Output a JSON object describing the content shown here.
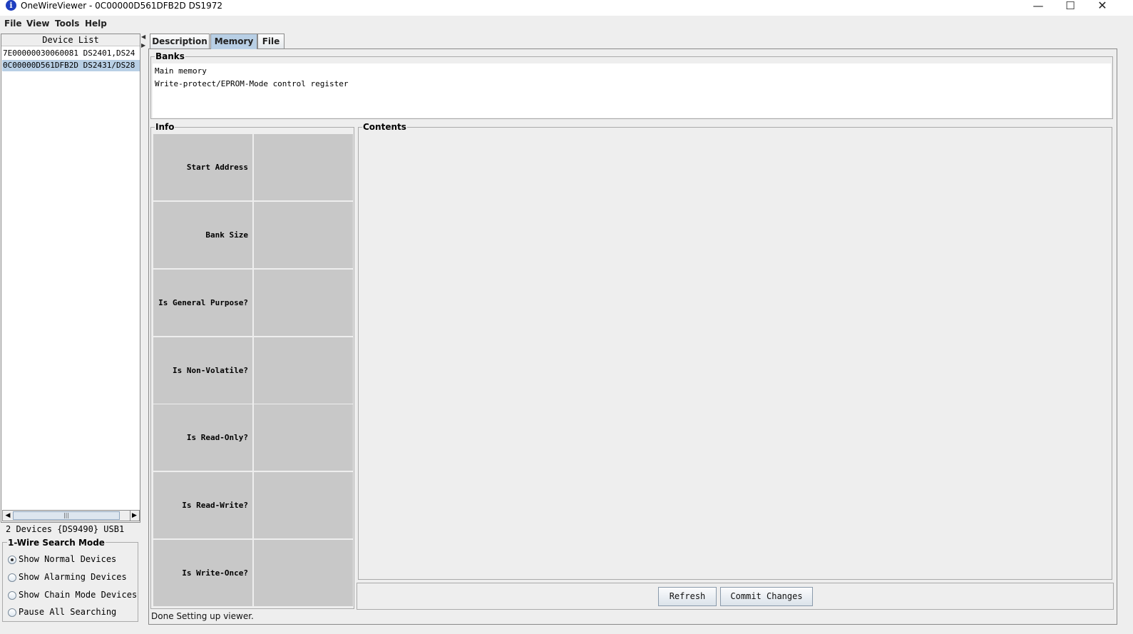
{
  "window": {
    "title": "OneWireViewer - 0C00000D561DFB2D DS1972",
    "app_icon": "info-icon",
    "minimize_glyph": "—",
    "maximize_glyph": "☐",
    "close_glyph": "✕"
  },
  "menu": [
    "File",
    "View",
    "Tools",
    "Help"
  ],
  "device_list": {
    "header": "Device List",
    "devices": [
      {
        "label": "7E00000030060081 DS2401,DS24",
        "selected": false
      },
      {
        "label": "0C00000D561DFB2D DS2431/DS28",
        "selected": true
      }
    ],
    "count_text": "2 Devices  {DS9490} USB1"
  },
  "search_mode": {
    "title": "1-Wire Search Mode",
    "options": [
      {
        "label": "Show Normal Devices",
        "selected": true
      },
      {
        "label": "Show Alarming Devices",
        "selected": false
      },
      {
        "label": "Show Chain Mode Devices",
        "selected": false
      },
      {
        "label": "Pause All Searching",
        "selected": false
      }
    ]
  },
  "tabs": [
    {
      "label": "Description",
      "active": false
    },
    {
      "label": "Memory",
      "active": true
    },
    {
      "label": "File",
      "active": false
    }
  ],
  "banks": {
    "title": "Banks",
    "items": [
      "Main memory",
      "Write-protect/EPROM-Mode control register"
    ]
  },
  "info": {
    "title": "Info",
    "rows": [
      {
        "label": "Start Address",
        "value": ""
      },
      {
        "label": "Bank Size",
        "value": ""
      },
      {
        "label": "Is General Purpose?",
        "value": ""
      },
      {
        "label": "Is Non-Volatile?",
        "value": ""
      },
      {
        "label": "Is Read-Only?",
        "value": ""
      },
      {
        "label": "Is Read-Write?",
        "value": ""
      },
      {
        "label": "Is Write-Once?",
        "value": ""
      }
    ]
  },
  "contents": {
    "title": "Contents"
  },
  "buttons": {
    "refresh": "Refresh",
    "commit": "Commit Changes"
  },
  "status": "Done Setting up viewer."
}
